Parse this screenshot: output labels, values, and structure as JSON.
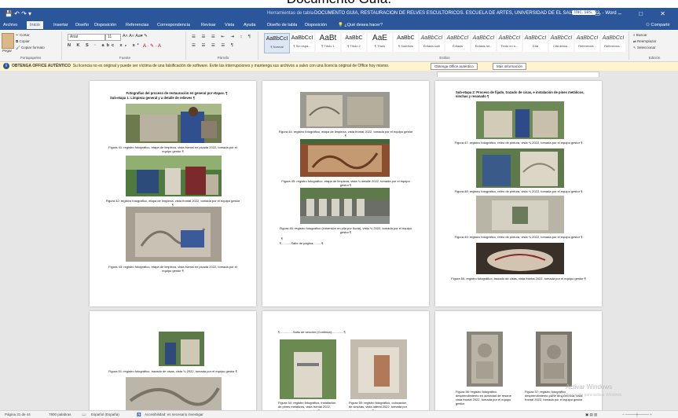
{
  "caption_top": "Documento Guía.",
  "window": {
    "context_tab": "Herramientas de tabla",
    "document_title": "DOCUMENTO GUIA, RESTAURACION DE RELVES ESCULTORICOS. ESCUELA DE ARTES, UNIVERSIDAD DE EL SALVADOR 2022. - Word",
    "user": "Inic. ses."
  },
  "tabs": [
    "Archivo",
    "Inicio",
    "Insertar",
    "Diseño",
    "Disposición",
    "Referencias",
    "Correspondencia",
    "Revisar",
    "Vista",
    "Ayuda",
    "Diseño de tabla",
    "Disposición"
  ],
  "tell_me": "¿Qué desea hacer?",
  "share": "Compartir",
  "clipboard": {
    "cut": "Cortar",
    "copy": "Copiar",
    "paste": "Pegar",
    "format_painter": "Copiar formato",
    "label": "Portapapeles"
  },
  "font": {
    "name": "Arial",
    "size": "11",
    "label": "Fuente",
    "format_row": "N K S · abc x₂ x²"
  },
  "paragraph": {
    "label": "Párrafo",
    "row": "☰ ☰ ☰ ☰ ¶"
  },
  "styles": {
    "label": "Estilos",
    "items": [
      {
        "preview": "AaBbCcI",
        "name": "¶ Normal"
      },
      {
        "preview": "AaBbCcI",
        "name": "¶ Sin espa..."
      },
      {
        "preview": "AaBt",
        "name": "¶ Título 1"
      },
      {
        "preview": "AaBbC",
        "name": "¶ Título 2"
      },
      {
        "preview": "AaE",
        "name": "¶ Título"
      },
      {
        "preview": "AaBbC",
        "name": "¶ Subtítulo"
      },
      {
        "preview": "AaBbCcI",
        "name": "Énfasis sutil"
      },
      {
        "preview": "AaBbCcI",
        "name": "Énfasis"
      },
      {
        "preview": "AaBbCcI",
        "name": "Énfasis int..."
      },
      {
        "preview": "AaBbCcI",
        "name": "Texto en n..."
      },
      {
        "preview": "AaBbCcI",
        "name": "Cita"
      },
      {
        "preview": "AaBbCcI",
        "name": "Cita desta..."
      },
      {
        "preview": "AaBbCcI",
        "name": "Referencia..."
      },
      {
        "preview": "AaBbCcI",
        "name": "Referencia..."
      }
    ]
  },
  "editing": {
    "find": "Buscar",
    "replace": "Reemplazar",
    "select": "Seleccionar",
    "label": "Edición"
  },
  "infobar": {
    "title": "OBTENGA OFFICE AUTÉNTICO",
    "message": "Su licencia no es original y puede ser víctima de una falsificación de software. Evite las interrupciones y mantenga sus archivos a salvo con una licencia original de Office hoy mismo.",
    "button_primary": "Obtenga Office auténtico",
    "button_secondary": "Más información"
  },
  "pages": {
    "p1": {
      "heading": "Fotografías del proceso de restauración en general por etapas. ¶",
      "subheading": "Sub-etapa 1: Limpieza general y a detalle de relieves ¶",
      "cap1": "Figura 41: registro fotográfico, etapa de limpieza, vista frontal en picada 2022, tomada por el equipo gestor ¶",
      "cap2": "Figura 42: registro fotográfico, etapa de limpieza, vista frontal 2022, tomada por el equipo gestor ¶",
      "cap3": "Figura 43: registro fotográfico, etapa de limpieza, vista frontal en picada 2022, tomada por el equipo gestor ¶"
    },
    "p2": {
      "cap1": "Figura 44: registro fotográfico, etapa de limpieza, vista frontal 2022, tomada por el equipo gestor ¶",
      "cap2": "Figura 45: registro fotográfico, etapa de limpieza, vista ¾ detalle 2022, tomada por el equipo gestor ¶",
      "cap3": "Figura 46: registro fotográfico (inmersión en pila por lluvia), vista ¾ 2022, tomada por el equipo gestor ¶",
      "pagebreak": "Salto de página"
    },
    "p3": {
      "heading": "Sub-etapa 2: Proceso de fijado, trazado de cisas, e instalación de pines metálicos, sinchas y resanado ¶",
      "cap1": "Figura 47: registro fotográfico, retiro de pintura, vista ¾ 2022, tomada por el equipo gestor ¶",
      "cap2": "Figura 48: registro fotográfico, retiro de pintura, vista ¾ 2022, tomada por el equipo gestor ¶",
      "cap3": "Figura 49: registro fotográfico, retiro de pintura, vista ¾ 2022, tomada por el equipo gestor ¶",
      "cap4": "Figura 50: registro fotográfico, trazado de cisas, vista frontal 2022, tomada por el equipo gestor ¶"
    },
    "p4": {
      "cap1": "Figura 51: registro fotográfico, trazado de cisas, vista ¾ 2022, tomada por el equipo gestor ¶"
    },
    "p5": {
      "section_break": "Salto de sección (Continua)",
      "cap1": "Figura 54: registro fotográfico, instalación de pines metálicos, vista frontal 2022, tomada por el equipo gestor ¶",
      "cap2": "Figura 55: registro fotográfico, colocación de sinchas, vista lateral 2022, tomada por el equipo gestor ¶"
    },
    "p6": {
      "cap1": "Figura 56: registro fotográfico desprendimiento en actividad de resane vista frontal 2022, tomada por el equipo gestor",
      "cap2": "Figura 57: registro fotográfico desprendimiento parte desprendida, vista frontal 2022, tomada por el equipo gestor"
    }
  },
  "status": {
    "page": "Página 31 de 44",
    "words": "7800 palabras",
    "lang": "Español (España)",
    "accessibility": "Accesibilidad: es necesario investigar"
  },
  "watermark": {
    "line1": "Activar Windows",
    "line2": "Ve a Configuración para activar Windows."
  }
}
